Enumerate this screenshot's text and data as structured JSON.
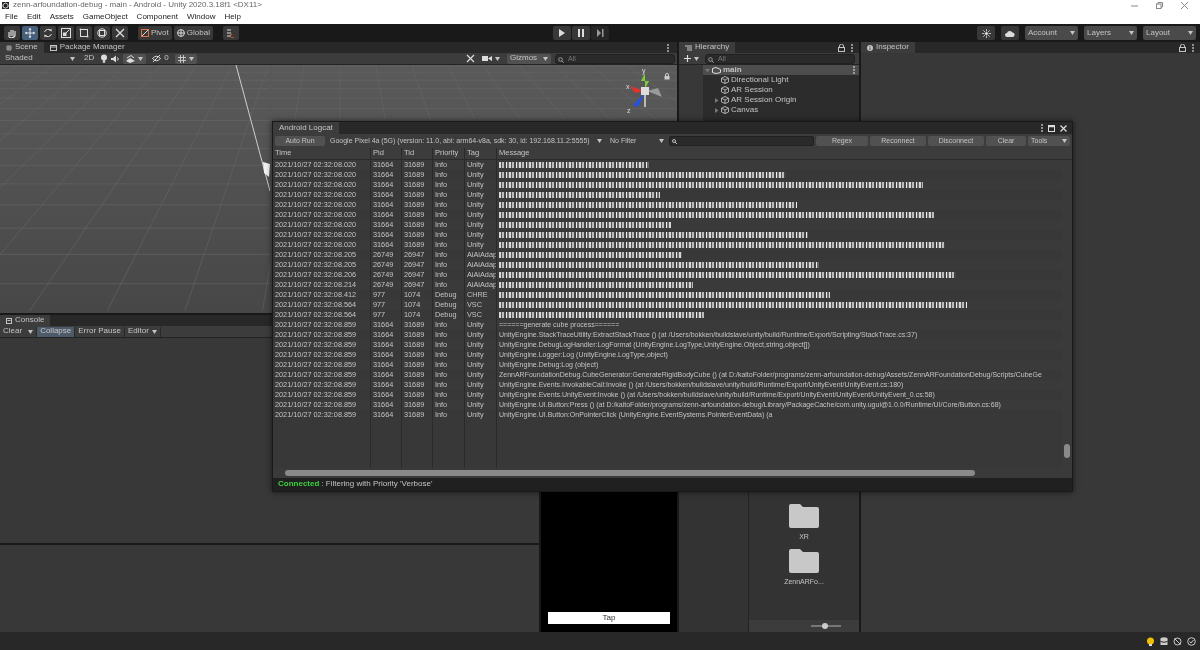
{
  "window": {
    "title": "zenn-arfoundation-debug - main - Android - Unity 2020.3.18f1 <DX11>"
  },
  "menu": [
    "File",
    "Edit",
    "Assets",
    "GameObject",
    "Component",
    "Window",
    "Help"
  ],
  "toolbar": {
    "tools": [
      {
        "kind": "hand",
        "selected": false
      },
      {
        "kind": "move",
        "selected": true
      },
      {
        "kind": "rotate",
        "selected": false
      },
      {
        "kind": "scale",
        "selected": false
      },
      {
        "kind": "rect",
        "selected": false
      },
      {
        "kind": "transform",
        "selected": false
      },
      {
        "kind": "custom",
        "selected": false
      }
    ],
    "pivot": "Pivot",
    "global": "Global",
    "dropdowns": [
      "Account",
      "Layers",
      "Layout"
    ]
  },
  "scene": {
    "tabs": [
      {
        "label": "Scene",
        "selected": true
      },
      {
        "label": "Package Manager",
        "selected": false
      }
    ],
    "shading": "Shaded",
    "mode_2d": "2D",
    "hidden_count": "0",
    "gizmos": "Gizmos",
    "search_placeholder": "All",
    "axis_labels": [
      "y",
      "x",
      "z"
    ]
  },
  "hierarchy": {
    "title": "Hierarchy",
    "search_placeholder": "All",
    "items": [
      {
        "label": "main",
        "kind": "scene",
        "expanded": true,
        "children": [
          {
            "label": "Directional Light",
            "kind": "object"
          },
          {
            "label": "AR Session",
            "kind": "object"
          },
          {
            "label": "AR Session Origin",
            "kind": "object",
            "expanded": false
          },
          {
            "label": "Canvas",
            "kind": "object",
            "expanded": false
          }
        ]
      }
    ]
  },
  "inspector": {
    "title": "Inspector"
  },
  "console": {
    "title": "Console",
    "buttons": [
      {
        "label": "Clear",
        "kind": "split",
        "on": false
      },
      {
        "label": "Collapse",
        "kind": "toggle",
        "on": true
      },
      {
        "label": "Error Pause",
        "kind": "toggle",
        "on": false
      },
      {
        "label": "Editor",
        "kind": "dropdown",
        "on": false
      }
    ]
  },
  "game": {
    "button": "Tap"
  },
  "project": {
    "folders": [
      "XR",
      "ZennARFo..."
    ],
    "zoom": {
      "level": 0.45
    }
  },
  "logcat": {
    "title": "Android Logcat",
    "auto_run": "Auto Run",
    "device": "Google Pixel 4a (5G) (version: 11.0, abi: arm64-v8a, sdk: 30, id: 192.168.11.2:5555)",
    "filter": "No Filter",
    "buttons": [
      "Regex",
      "Reconnect",
      "Disconnect",
      "Clear"
    ],
    "tools": "Tools",
    "columns": [
      "Time",
      "Pid",
      "Tid",
      "Priority",
      "Tag",
      "Message"
    ],
    "rows": [
      {
        "time": "2021/10/27 02:32:08.020",
        "pid": "31664",
        "tid": "31689",
        "priority": "Info",
        "tag": "Unity",
        "redacted": true
      },
      {
        "time": "2021/10/27 02:32:08.020",
        "pid": "31664",
        "tid": "31689",
        "priority": "Info",
        "tag": "Unity",
        "redacted": true
      },
      {
        "time": "2021/10/27 02:32:08.020",
        "pid": "31664",
        "tid": "31689",
        "priority": "Info",
        "tag": "Unity",
        "redacted": true
      },
      {
        "time": "2021/10/27 02:32:08.020",
        "pid": "31664",
        "tid": "31689",
        "priority": "Info",
        "tag": "Unity",
        "redacted": true
      },
      {
        "time": "2021/10/27 02:32:08.020",
        "pid": "31664",
        "tid": "31689",
        "priority": "Info",
        "tag": "Unity",
        "redacted": true
      },
      {
        "time": "2021/10/27 02:32:08.020",
        "pid": "31664",
        "tid": "31689",
        "priority": "Info",
        "tag": "Unity",
        "redacted": true
      },
      {
        "time": "2021/10/27 02:32:08.020",
        "pid": "31664",
        "tid": "31689",
        "priority": "Info",
        "tag": "Unity",
        "redacted": true
      },
      {
        "time": "2021/10/27 02:32:08.020",
        "pid": "31664",
        "tid": "31689",
        "priority": "Info",
        "tag": "Unity",
        "redacted": true
      },
      {
        "time": "2021/10/27 02:32:08.020",
        "pid": "31664",
        "tid": "31689",
        "priority": "Info",
        "tag": "Unity",
        "redacted": true
      },
      {
        "time": "2021/10/27 02:32:08.205",
        "pid": "26749",
        "tid": "26947",
        "priority": "Info",
        "tag": "AiAiAdap",
        "redacted": true
      },
      {
        "time": "2021/10/27 02:32:08.205",
        "pid": "26749",
        "tid": "26947",
        "priority": "Info",
        "tag": "AiAiAdap",
        "redacted": true
      },
      {
        "time": "2021/10/27 02:32:08.206",
        "pid": "26749",
        "tid": "26947",
        "priority": "Info",
        "tag": "AiAiAdap",
        "redacted": true
      },
      {
        "time": "2021/10/27 02:32:08.214",
        "pid": "26749",
        "tid": "26947",
        "priority": "Info",
        "tag": "AiAiAdap",
        "redacted": true
      },
      {
        "time": "2021/10/27 02:32:08.412",
        "pid": "977",
        "tid": "1074",
        "priority": "Debug",
        "tag": "CHRE",
        "redacted": true
      },
      {
        "time": "2021/10/27 02:32:08.564",
        "pid": "977",
        "tid": "1074",
        "priority": "Debug",
        "tag": "VSC",
        "redacted": true
      },
      {
        "time": "2021/10/27 02:32:08.564",
        "pid": "977",
        "tid": "1074",
        "priority": "Debug",
        "tag": "VSC",
        "redacted": true
      },
      {
        "time": "2021/10/27 02:32:08.859",
        "pid": "31664",
        "tid": "31689",
        "priority": "Info",
        "tag": "Unity",
        "redacted": false,
        "message": "======generate cube process======"
      },
      {
        "time": "2021/10/27 02:32:08.859",
        "pid": "31664",
        "tid": "31689",
        "priority": "Info",
        "tag": "Unity",
        "redacted": false,
        "message": "UnityEngine.StackTraceUtility:ExtractStackTrace () (at /Users/bokken/buildslave/unity/build/Runtime/Export/Scripting/StackTrace.cs:37)"
      },
      {
        "time": "2021/10/27 02:32:08.859",
        "pid": "31664",
        "tid": "31689",
        "priority": "Info",
        "tag": "Unity",
        "redacted": false,
        "message": "UnityEngine.DebugLogHandler:LogFormat (UnityEngine.LogType,UnityEngine.Object,string,object[])"
      },
      {
        "time": "2021/10/27 02:32:08.859",
        "pid": "31664",
        "tid": "31689",
        "priority": "Info",
        "tag": "Unity",
        "redacted": false,
        "message": "UnityEngine.Logger:Log (UnityEngine.LogType,object)"
      },
      {
        "time": "2021/10/27 02:32:08.859",
        "pid": "31664",
        "tid": "31689",
        "priority": "Info",
        "tag": "Unity",
        "redacted": false,
        "message": "UnityEngine.Debug:Log (object)"
      },
      {
        "time": "2021/10/27 02:32:08.859",
        "pid": "31664",
        "tid": "31689",
        "priority": "Info",
        "tag": "Unity",
        "redacted": false,
        "message": "ZennARFoundationDebug.CubeGenerator:GenerateRigidBodyCube () (at D:/kaitoFolder/programs/zenn-arfoundation-debug/Assets/ZennARFoundationDebug/Scripts/CubeGe"
      },
      {
        "time": "2021/10/27 02:32:08.859",
        "pid": "31664",
        "tid": "31689",
        "priority": "Info",
        "tag": "Unity",
        "redacted": false,
        "message": "UnityEngine.Events.InvokableCall:Invoke () (at /Users/bokken/buildslave/unity/build/Runtime/Export/UnityEvent/UnityEvent.cs:180)"
      },
      {
        "time": "2021/10/27 02:32:08.859",
        "pid": "31664",
        "tid": "31689",
        "priority": "Info",
        "tag": "Unity",
        "redacted": false,
        "message": "UnityEngine.Events.UnityEvent:Invoke () (at /Users/bokken/buildslave/unity/build/Runtime/Export/UnityEvent/UnityEvent/UnityEvent_0.cs:58)"
      },
      {
        "time": "2021/10/27 02:32:08.859",
        "pid": "31664",
        "tid": "31689",
        "priority": "Info",
        "tag": "Unity",
        "redacted": false,
        "message": "UnityEngine.UI.Button:Press () (at D:/kaitoFolder/programs/zenn-arfoundation-debug/Library/PackageCache/com.unity.ugui@1.0.0/Runtime/UI/Core/Button.cs:68)"
      },
      {
        "time": "2021/10/27 02:32:08.859",
        "pid": "31664",
        "tid": "31689",
        "priority": "Info",
        "tag": "Unity",
        "redacted": false,
        "message": "UnityEngine.UI.Button:OnPointerClick (UnityEngine.EventSystems.PointerEventData) (a"
      }
    ],
    "status": {
      "connected": true,
      "label": "Connected",
      "message": ": Filtering with Priority 'Verbose'"
    }
  }
}
